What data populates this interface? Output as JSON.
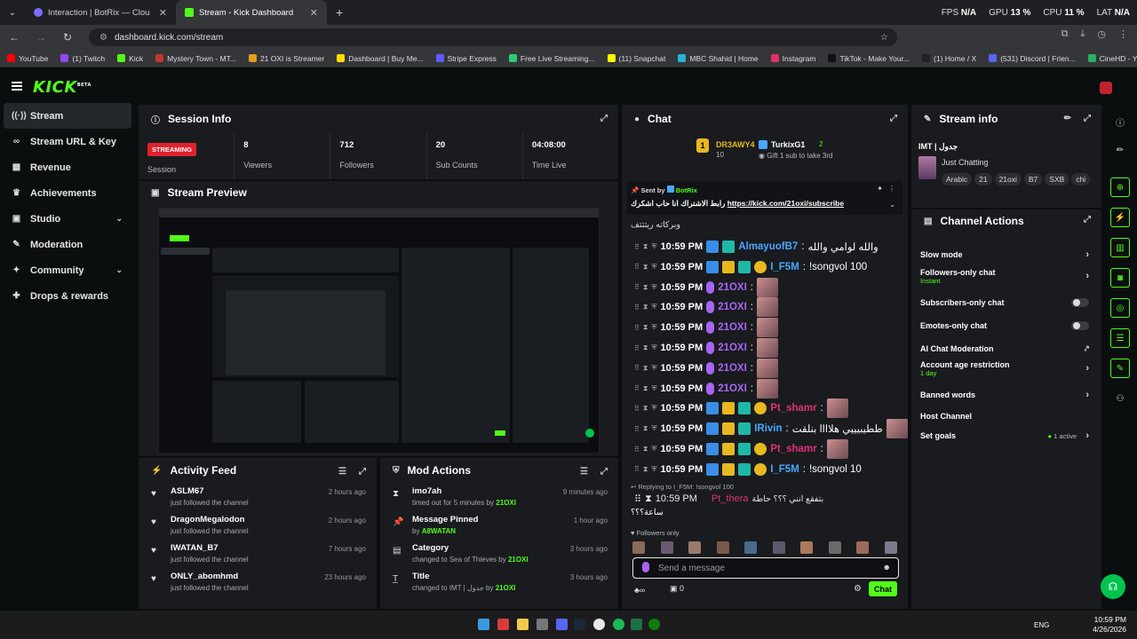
{
  "browser": {
    "tabs": [
      {
        "title": "Interaction | BotRix — Clou",
        "active": false
      },
      {
        "title": "Stream - Kick Dashboard",
        "active": true
      }
    ],
    "hud": {
      "fps_label": "FPS",
      "fps": "N/A",
      "gpu_label": "GPU",
      "gpu": "13 %",
      "cpu_label": "CPU",
      "cpu": "11 %",
      "lat_label": "LAT",
      "lat": "N/A"
    },
    "url": "dashboard.kick.com/stream",
    "bookmarks": [
      {
        "label": "YouTube",
        "color": "#ff0000"
      },
      {
        "label": "(1) Twitch",
        "color": "#9146ff"
      },
      {
        "label": "Kick",
        "color": "#53fc18"
      },
      {
        "label": "Mystery Town - MT...",
        "color": "#c0392b"
      },
      {
        "label": "21 OXI is Streamer",
        "color": "#e0a020"
      },
      {
        "label": "Dashboard | Buy Me...",
        "color": "#ffdd00"
      },
      {
        "label": "Stripe Express",
        "color": "#635bff"
      },
      {
        "label": "Free Live Streaming...",
        "color": "#2ecc71"
      },
      {
        "label": "(11) Snapchat",
        "color": "#fffc00"
      },
      {
        "label": "MBC Shahid | Home",
        "color": "#2ab3d6"
      },
      {
        "label": "Instagram",
        "color": "#e1306c"
      },
      {
        "label": "TikTok - Make Your...",
        "color": "#111111"
      },
      {
        "label": "(1) Home / X",
        "color": "#222222"
      },
      {
        "label": "(531) Discord | Frien...",
        "color": "#5865f2"
      },
      {
        "label": "CineHD - Your Ultim...",
        "color": "#27ae60"
      }
    ]
  },
  "kick": {
    "logo": "KICK",
    "beta": "BETA"
  },
  "sidebar": {
    "items": [
      {
        "label": "Stream",
        "icon": "broadcast-icon",
        "glyph": "((·))"
      },
      {
        "label": "Stream URL & Key",
        "icon": "link-icon",
        "glyph": "∞"
      },
      {
        "label": "Revenue",
        "icon": "revenue-icon",
        "glyph": "▦"
      },
      {
        "label": "Achievements",
        "icon": "trophy-icon",
        "glyph": "♛"
      },
      {
        "label": "Studio",
        "icon": "studio-icon",
        "glyph": "▣"
      },
      {
        "label": "Moderation",
        "icon": "wrench-icon",
        "glyph": "✎"
      },
      {
        "label": "Community",
        "icon": "community-icon",
        "glyph": "✦"
      },
      {
        "label": "Drops & rewards",
        "icon": "gift-icon",
        "glyph": "✚"
      }
    ]
  },
  "session": {
    "title": "Session Info",
    "live_badge": "STREAMING",
    "session_label": "Session",
    "stats": [
      {
        "value": "8",
        "label": "Viewers"
      },
      {
        "value": "712",
        "label": "Followers"
      },
      {
        "value": "20",
        "label": "Sub Counts"
      },
      {
        "value": "04:08:00",
        "label": "Time Live"
      }
    ]
  },
  "preview": {
    "title": "Stream Preview"
  },
  "activity": {
    "title": "Activity Feed",
    "items": [
      {
        "name": "ASLM67",
        "sub": "just followed the channel",
        "ago": "2 hours ago"
      },
      {
        "name": "DragonMegalodon",
        "sub": "just followed the channel",
        "ago": "2 hours ago"
      },
      {
        "name": "IWATAN_B7",
        "sub": "just followed the channel",
        "ago": "7 hours ago"
      },
      {
        "name": "ONLY_abomhmd",
        "sub": "just followed the channel",
        "ago": "23 hours ago"
      }
    ]
  },
  "mod": {
    "title": "Mod Actions",
    "items": [
      {
        "name": "imo7ah",
        "sub": "timed out for 5 minutes by",
        "by": "21OXI",
        "ago": "9 minutes ago",
        "icon": "timeout-icon",
        "glyph": "⧗"
      },
      {
        "name": "Message Pinned",
        "sub": "by",
        "by": "A8WATAN",
        "ago": "1 hour ago",
        "icon": "pin-icon",
        "glyph": "📌"
      },
      {
        "name": "Category",
        "sub": "changed to Sea of Thieves by",
        "by": "21OXI",
        "ago": "3 hours ago",
        "icon": "category-icon",
        "glyph": "▤"
      },
      {
        "name": "Title",
        "sub": "changed to IMT | جدول by",
        "by": "21OXI",
        "ago": "3 hours ago",
        "icon": "title-icon",
        "glyph": "T̲"
      }
    ]
  },
  "chat": {
    "title": "Chat",
    "leaderboard": [
      {
        "name": "DR3AWY4",
        "count": "10"
      },
      {
        "name": "TurkixG1",
        "count": "2"
      }
    ],
    "gift_text": "Gift 1 sub to take 3rd",
    "pinned": {
      "sent_by": "Sent by",
      "bot": "BotRix",
      "text": "رابط الاشتراك انا حاب اشكرك",
      "link": "https://kick.com/21oxi/subscribe"
    },
    "partial_line": "وبركاته ريتتتف",
    "time": "10:59 PM",
    "messages": [
      {
        "user": "AlmayuofB7",
        "color": "#4aa8ff",
        "text": "والله لوامي والله",
        "emote": false,
        "sub": false
      },
      {
        "user": "I_F5M",
        "color": "#4aa8ff",
        "text": "!songvol 100",
        "emote": false,
        "sub": true
      },
      {
        "user": "21OXI",
        "color": "#a864f5",
        "text": "",
        "emote": true,
        "sub": false
      },
      {
        "user": "21OXI",
        "color": "#a864f5",
        "text": "",
        "emote": true,
        "sub": false
      },
      {
        "user": "21OXI",
        "color": "#a864f5",
        "text": "",
        "emote": true,
        "sub": false
      },
      {
        "user": "21OXI",
        "color": "#a864f5",
        "text": "",
        "emote": true,
        "sub": false
      },
      {
        "user": "21OXI",
        "color": "#a864f5",
        "text": "",
        "emote": true,
        "sub": false
      },
      {
        "user": "21OXI",
        "color": "#a864f5",
        "text": "",
        "emote": true,
        "sub": false
      },
      {
        "user": "Pt_shamr",
        "color": "#e0307a",
        "text": "",
        "emote": true,
        "sub": true
      },
      {
        "user": "IRivin",
        "color": "#4aa8ff",
        "text": "ططيبيييي هلاااا بنلقت",
        "emote": true,
        "sub": false
      },
      {
        "user": "Pt_shamr",
        "color": "#e0307a",
        "text": "",
        "emote": true,
        "sub": true
      },
      {
        "user": "I_F5M",
        "color": "#4aa8ff",
        "text": "!songvol 10",
        "emote": false,
        "sub": true
      }
    ],
    "reply_to": "Replying to I_F5M: !songvol 100",
    "last_message": {
      "user": "Pt_thera",
      "color": "#e0307a",
      "text": "بتفقع انني ؟؟؟ حاطة",
      "text2": "ساعة؟؟؟"
    },
    "followers_only": "Followers only",
    "input_placeholder": "Send a message",
    "points": "0",
    "send_label": "Chat"
  },
  "stream_info": {
    "title": "Stream info",
    "stream_title": "IMT | جدول",
    "category": "Just Chatting",
    "tags": [
      "Arabic",
      "21",
      "21oxi",
      "B7",
      "SXB",
      "chi"
    ]
  },
  "channel_actions": {
    "title": "Channel Actions",
    "items": [
      {
        "label": "Slow mode",
        "sub": "",
        "kind": "arrow"
      },
      {
        "label": "Followers-only chat",
        "sub": "Instant",
        "kind": "arrow"
      },
      {
        "label": "Subscribers-only chat",
        "sub": "",
        "kind": "toggle"
      },
      {
        "label": "Emotes-only chat",
        "sub": "",
        "kind": "toggle"
      },
      {
        "label": "AI Chat Moderation",
        "sub": "",
        "kind": "external"
      },
      {
        "label": "Account age restriction",
        "sub": "1 day",
        "kind": "arrow"
      },
      {
        "label": "Banned words",
        "sub": "",
        "kind": "arrow"
      },
      {
        "label": "Host Channel",
        "sub": "",
        "kind": "none"
      },
      {
        "label": "Set goals",
        "sub": "",
        "kind": "goal",
        "goal_text": "1 active"
      }
    ]
  },
  "taskbar": {
    "lang": "ENG",
    "time": "10:59 PM",
    "date": "4/26/2026"
  }
}
